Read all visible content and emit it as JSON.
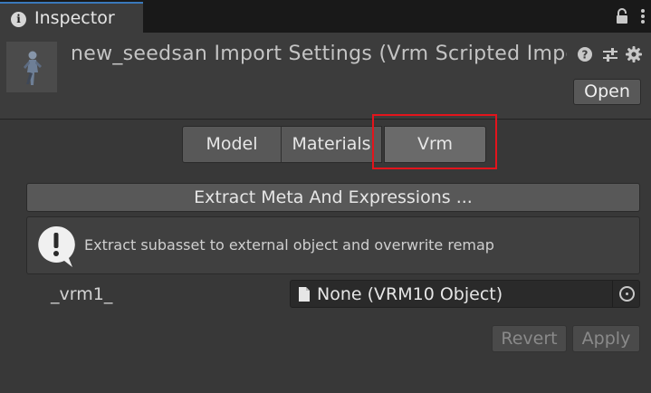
{
  "tab": {
    "title": "Inspector"
  },
  "header": {
    "title": "new_seedsan Import Settings (Vrm Scripted Importer)",
    "open_label": "Open"
  },
  "toolbar": {
    "tabs": [
      "Model",
      "Materials",
      "Vrm"
    ],
    "selected": "Vrm"
  },
  "extract_button": "Extract Meta And Expressions ...",
  "help": {
    "text": "Extract subasset to external object and overwrite remap"
  },
  "property": {
    "label": "_vrm1_",
    "value": "None (VRM10 Object)"
  },
  "footer": {
    "revert_label": "Revert",
    "apply_label": "Apply"
  },
  "colors": {
    "highlight": "#e3141c",
    "tab_accent": "#3a79bb"
  }
}
